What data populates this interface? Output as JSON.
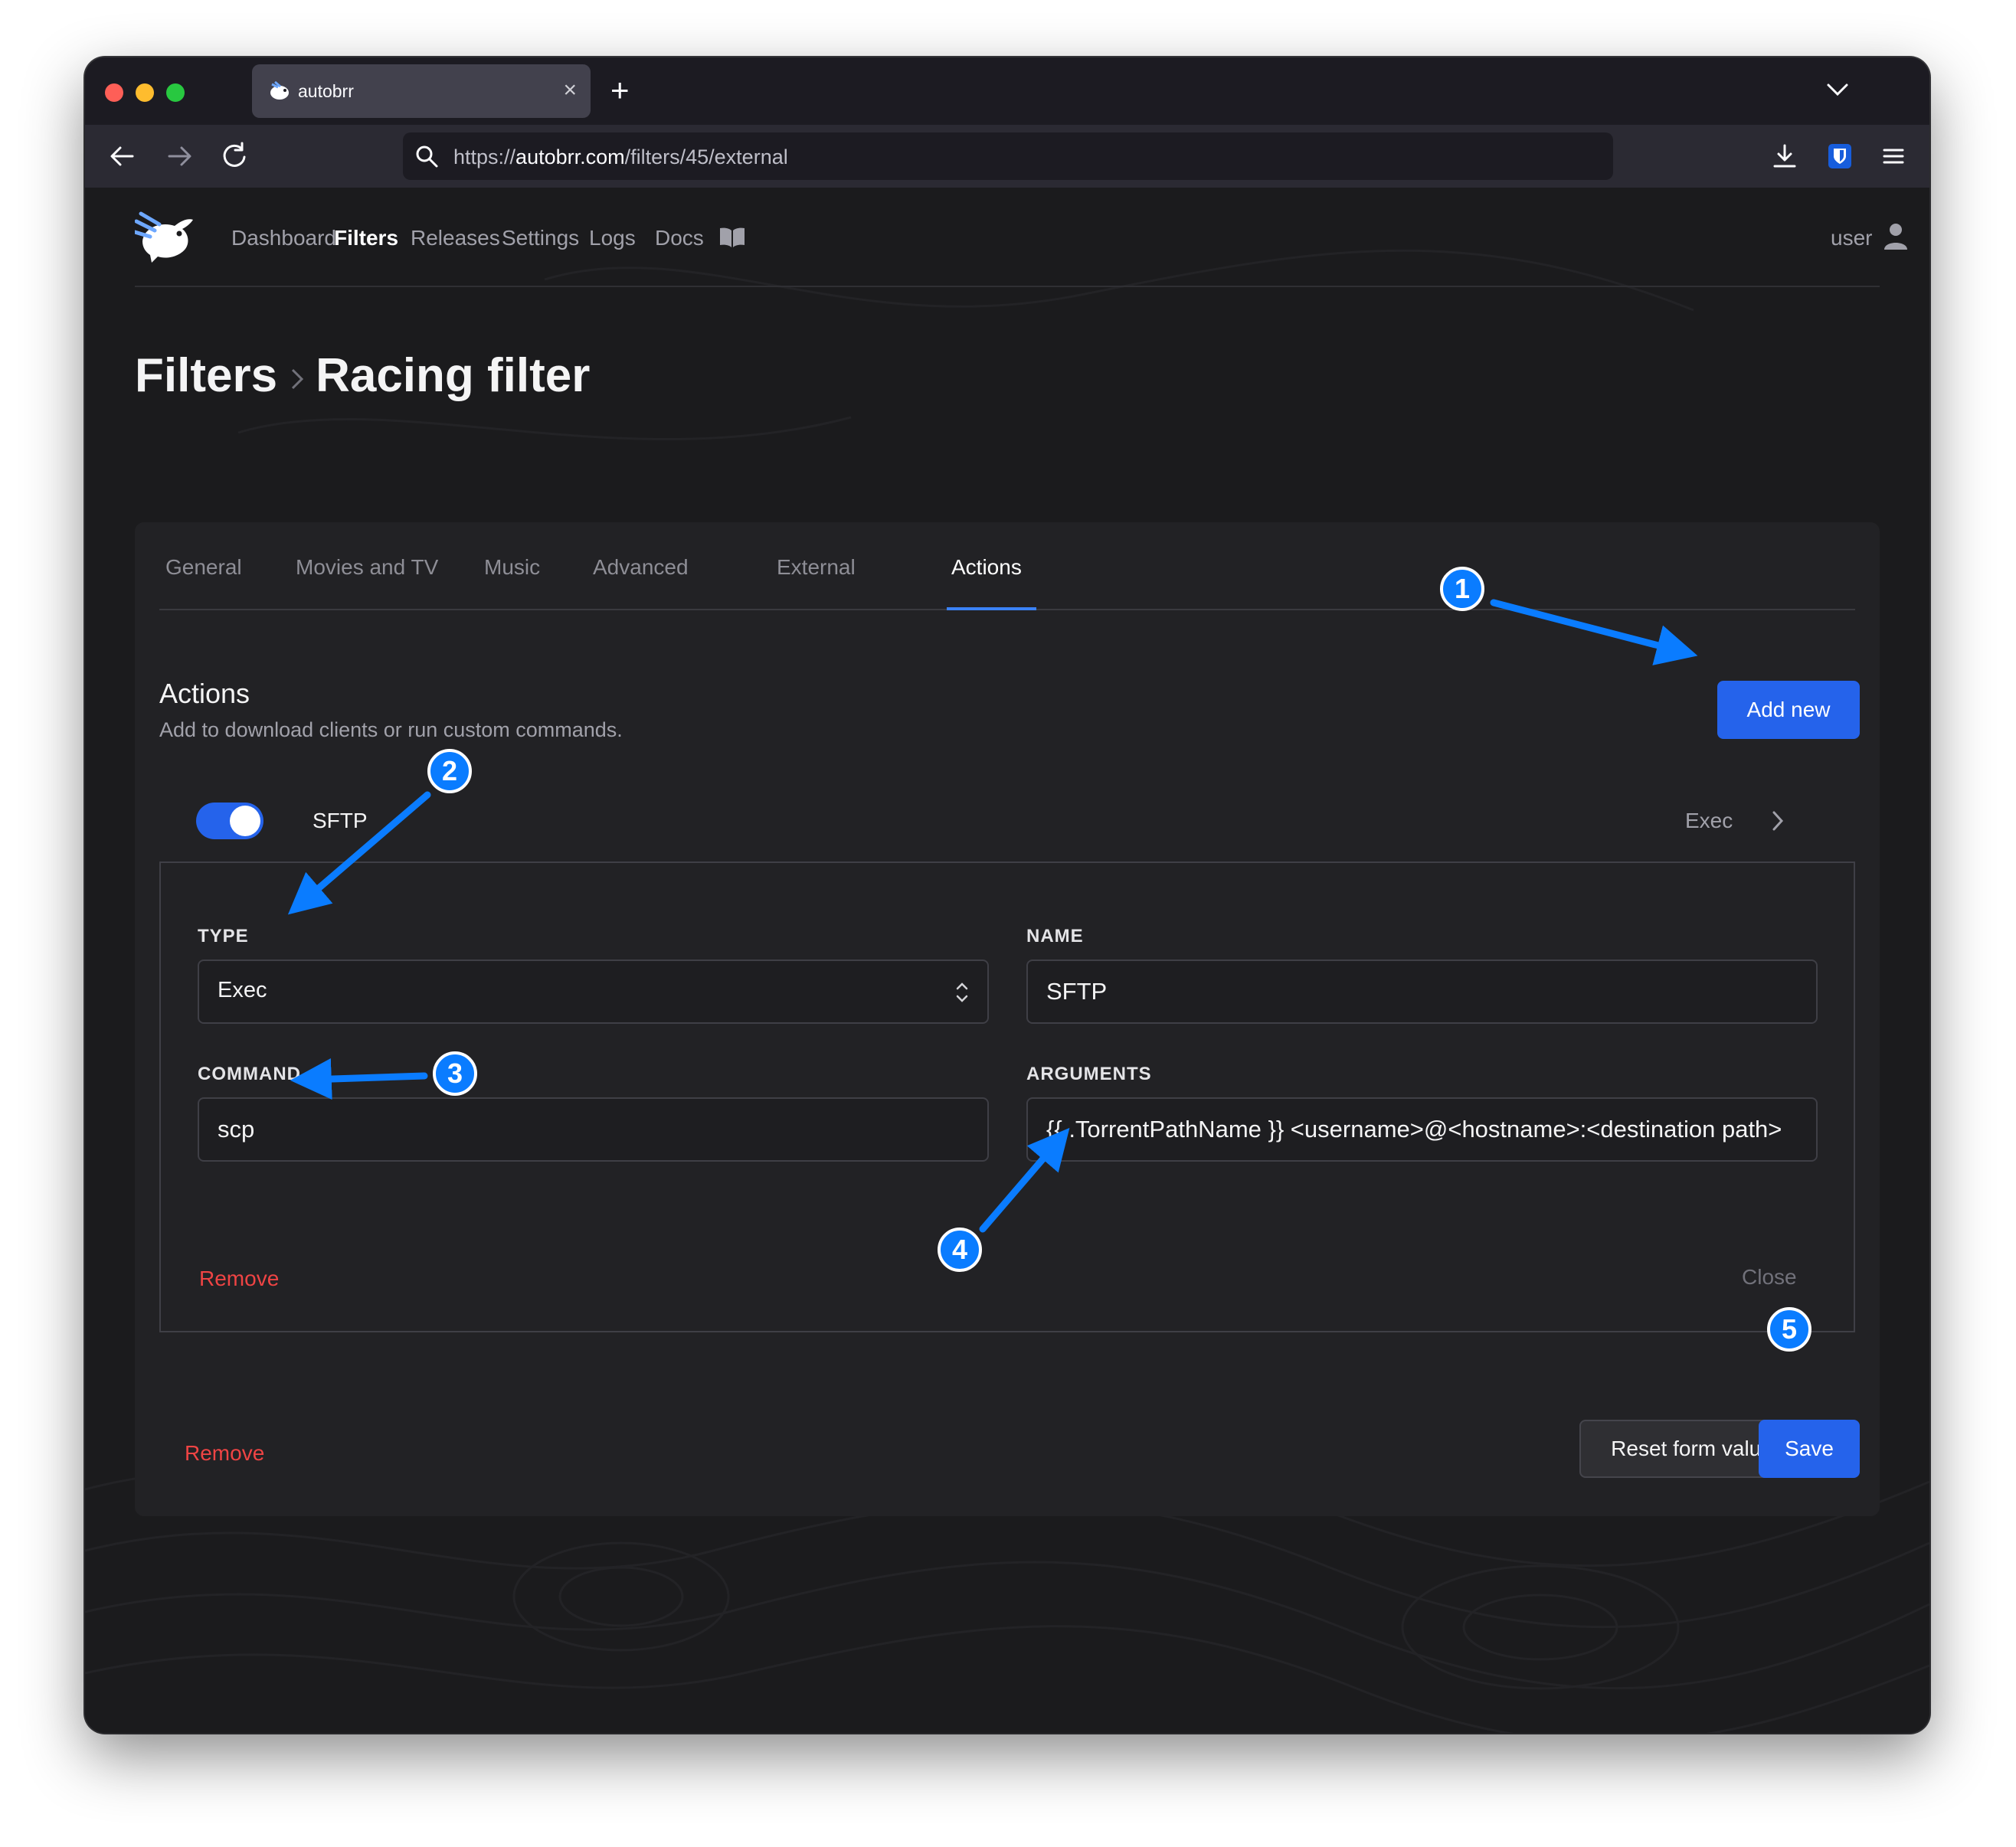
{
  "browser": {
    "tab_title": "autobrr",
    "new_tab_symbol": "+",
    "close_tab_symbol": "×",
    "url_scheme": "https://",
    "url_host": "autobrr.com",
    "url_path": "/filters/45/external"
  },
  "app_nav": {
    "items": [
      "Dashboard",
      "Filters",
      "Releases",
      "Settings",
      "Logs",
      "Docs"
    ],
    "active": "Filters",
    "user_label": "user"
  },
  "breadcrumb": {
    "parent": "Filters",
    "current": "Racing filter"
  },
  "tabs": {
    "items": [
      "General",
      "Movies and TV",
      "Music",
      "Advanced",
      "External",
      "Actions"
    ],
    "active": "Actions"
  },
  "actions_section": {
    "title": "Actions",
    "description": "Add to download clients or run custom commands.",
    "add_new_label": "Add new"
  },
  "action": {
    "enabled": true,
    "name": "SFTP",
    "type_summary": "Exec",
    "type_label": "TYPE",
    "type_value": "Exec",
    "name_label": "NAME",
    "name_value": "SFTP",
    "command_label": "COMMAND",
    "command_value": "scp",
    "arguments_label": "ARGUMENTS",
    "arguments_value": "{{ .TorrentPathName }} <username>@<hostname>:<destination path>",
    "remove_label": "Remove",
    "close_label": "Close"
  },
  "footer": {
    "remove_label": "Remove",
    "reset_label": "Reset form values",
    "save_label": "Save"
  },
  "annotations": {
    "badges": [
      "1",
      "2",
      "3",
      "4",
      "5"
    ],
    "color": "#0a7cff"
  },
  "colors": {
    "accent": "#2563eb",
    "danger": "#ef4444",
    "background": "#1b1b1d",
    "card": "#222225"
  }
}
